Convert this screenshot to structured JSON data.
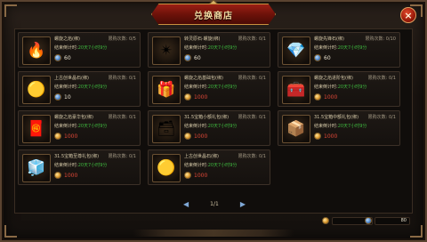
{
  "window": {
    "title": "兑换商店",
    "close_label": "×"
  },
  "labels": {
    "timer_label": "结束倒计时:"
  },
  "colors": {
    "timer_green": "#3fb83f",
    "price_red": "#e04838",
    "banner_red": "#9b1f14"
  },
  "items": [
    {
      "name": "螺旋之焰(绑)",
      "limit": "限购次数: 0/5",
      "timer": "20天7小时9分",
      "currency": "blue",
      "price": "60",
      "price_color": "white",
      "icon": "red-crystal-icon",
      "icon_glyph": "🔥"
    },
    {
      "name": "转灵原石·螺旋(绑)",
      "limit": "限购次数: 0/1",
      "timer": "20天7小时9分",
      "currency": "blue",
      "price": "60",
      "price_color": "white",
      "icon": "gold-stone-icon",
      "icon_glyph": "✴"
    },
    {
      "name": "螺旋先锋石(绑)",
      "limit": "限购次数: 0/10",
      "timer": "20天7小时9分",
      "currency": "blue",
      "price": "60",
      "price_color": "white",
      "icon": "crystal-cluster-icon",
      "icon_glyph": "💎"
    },
    {
      "name": "上古创世晶石(绑)",
      "limit": "限购次数: 0/1",
      "timer": "20天7小时9分",
      "currency": "blue",
      "price": "10",
      "price_color": "white",
      "icon": "gold-medallion-icon",
      "icon_glyph": "🟡"
    },
    {
      "name": "螺旋之焰基础包(绑)",
      "limit": "限购次数: 0/1",
      "timer": "20天7小时9分",
      "currency": "gold",
      "price": "1000",
      "price_color": "red",
      "icon": "red-giftbox-icon",
      "icon_glyph": "🎁"
    },
    {
      "name": "螺旋之焰进阶包(绑)",
      "limit": "限购次数: 0/1",
      "timer": "20天7小时9分",
      "currency": "gold",
      "price": "1000",
      "price_color": "red",
      "icon": "red-treasure-icon",
      "icon_glyph": "🧰"
    },
    {
      "name": "螺旋之焰豪华包(绑)",
      "limit": "限购次数: 0/1",
      "timer": "20天7小时9分",
      "currency": "gold",
      "price": "1000",
      "price_color": "red",
      "icon": "red-bag-icon",
      "icon_glyph": "🧧"
    },
    {
      "name": "31.5宝箱小额礼包(绑)",
      "limit": "限购次数: 0/1",
      "timer": "20天7小时9分",
      "currency": "gold",
      "price": "1000",
      "price_color": "red",
      "icon": "blue-chest-icon",
      "icon_glyph": "🗃"
    },
    {
      "name": "31.5宝箱中额礼包(绑)",
      "limit": "限购次数: 0/1",
      "timer": "20天7小时9分",
      "currency": "gold",
      "price": "1000",
      "price_color": "red",
      "icon": "blue-chest-open-icon",
      "icon_glyph": "📦"
    },
    {
      "name": "31.5宝箱至尊礼包(绑)",
      "limit": "限购次数: 0/1",
      "timer": "20天7小时9分",
      "currency": "gold",
      "price": "1000",
      "price_color": "red",
      "icon": "blue-cube-icon",
      "icon_glyph": "🧊"
    },
    {
      "name": "上古创世晶石(绑)",
      "limit": "限购次数: 0/1",
      "timer": "20天7小时9分",
      "currency": "gold",
      "price": "1000",
      "price_color": "red",
      "icon": "gold-medallion-icon",
      "icon_glyph": "🟡"
    }
  ],
  "pager": {
    "prev": "◀",
    "label": "1/1",
    "next": "▶"
  },
  "wallet": {
    "gold": "0",
    "blue": "80"
  }
}
